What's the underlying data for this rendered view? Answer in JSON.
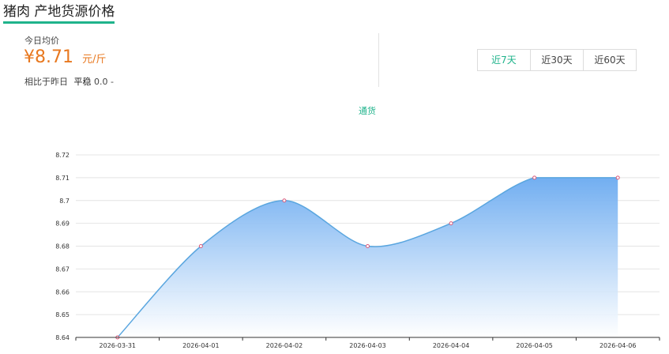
{
  "header": {
    "title": "猪肉 产地货源价格"
  },
  "summary": {
    "today_label": "今日均价",
    "price": "¥8.71",
    "unit": "元/斤",
    "compare_label": "相比于昨日",
    "trend": "平稳",
    "change": "0.0",
    "change_suffix": "-"
  },
  "range_tabs": [
    {
      "label": "近7天",
      "active": true
    },
    {
      "label": "近30天",
      "active": false
    },
    {
      "label": "近60天",
      "active": false
    }
  ],
  "colors": {
    "accent": "#1fb38b",
    "price": "#e8781f",
    "line": "#5aa6df",
    "area_top": "#6aaaf0"
  },
  "chart_data": {
    "type": "area",
    "series": [
      {
        "name": "通货",
        "x": [
          "2026-03-31",
          "2026-04-01",
          "2026-04-02",
          "2026-04-03",
          "2026-04-04",
          "2026-04-05",
          "2026-04-06"
        ],
        "values": [
          8.64,
          8.68,
          8.7,
          8.68,
          8.69,
          8.71,
          8.71
        ]
      }
    ],
    "xlabel": "",
    "ylabel": "",
    "ylim": [
      8.64,
      8.72
    ],
    "yticks": [
      "8.64",
      "8.65",
      "8.66",
      "8.67",
      "8.68",
      "8.69",
      "8.7",
      "8.71",
      "8.72"
    ],
    "grid": true,
    "smooth": true
  }
}
